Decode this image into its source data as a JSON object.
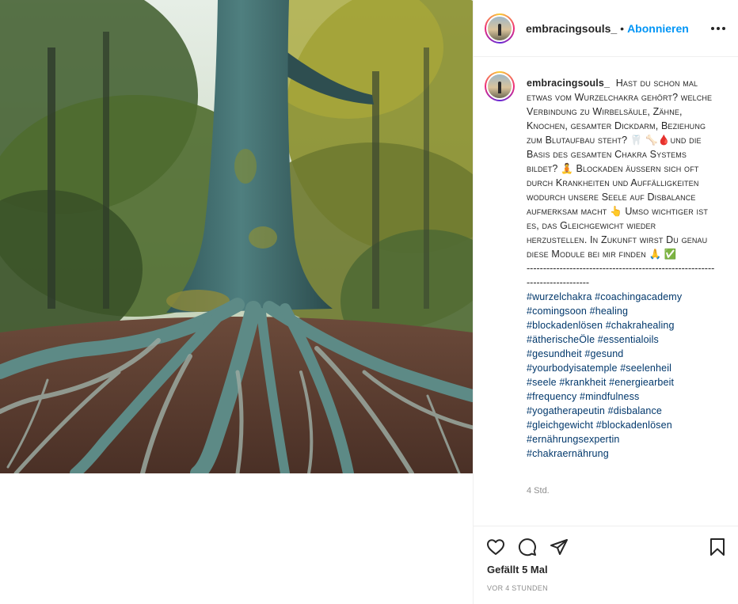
{
  "post": {
    "image_alt": "tree with exposed roots in a forest"
  },
  "header": {
    "username": "embracingsouls_",
    "separator": "•",
    "follow_label": "Abonnieren",
    "more_icon": "more-horizontal-icon"
  },
  "caption": {
    "username": "embracingsouls_",
    "text": "Hast du schon mal etwas vom Wurzelchakra gehört? welche Verbindung zu Wirbelsäule, Zähne, Knochen, gesamter Dickdarm, Beziehung zum Blutaufbau steht? 🦷 🦴🩸und die Basis des gesamten Chakra Systems bildet? 🧘 Blockaden äußern sich oft durch Krankheiten und Auffälligkeiten wodurch unsere Seele auf Disbalance aufmerksam macht 👆 Umso wichtiger ist es, das Gleichgewicht wieder herzustellen. In Zukunft wirst Du genau diese Module bei mir finden 🙏 ✅",
    "separator": "----------------------------------------------------------------------------",
    "hashtags": [
      "#wurzelchakra #coachingacademy",
      "#comingsoon #healing",
      "#blockadenlösen #chakrahealing",
      "#ätherischeÖle #essentialoils",
      "#gesundheit #gesund",
      "#yourbodyisatemple #seelenheil",
      "#seele #krankheit #energiearbeit",
      "#frequency #mindfulness",
      "#yogatherapeutin #disbalance",
      "#gleichgewicht #blockadenlösen",
      "#ernährungsexpertin",
      "#chakraernährung"
    ],
    "time": "4 Std."
  },
  "actions": {
    "like_icon": "heart-icon",
    "comment_icon": "comment-icon",
    "share_icon": "share-icon",
    "save_icon": "bookmark-icon",
    "likes_text": "Gefällt 5 Mal",
    "timestamp": "vor 4 Stunden"
  }
}
